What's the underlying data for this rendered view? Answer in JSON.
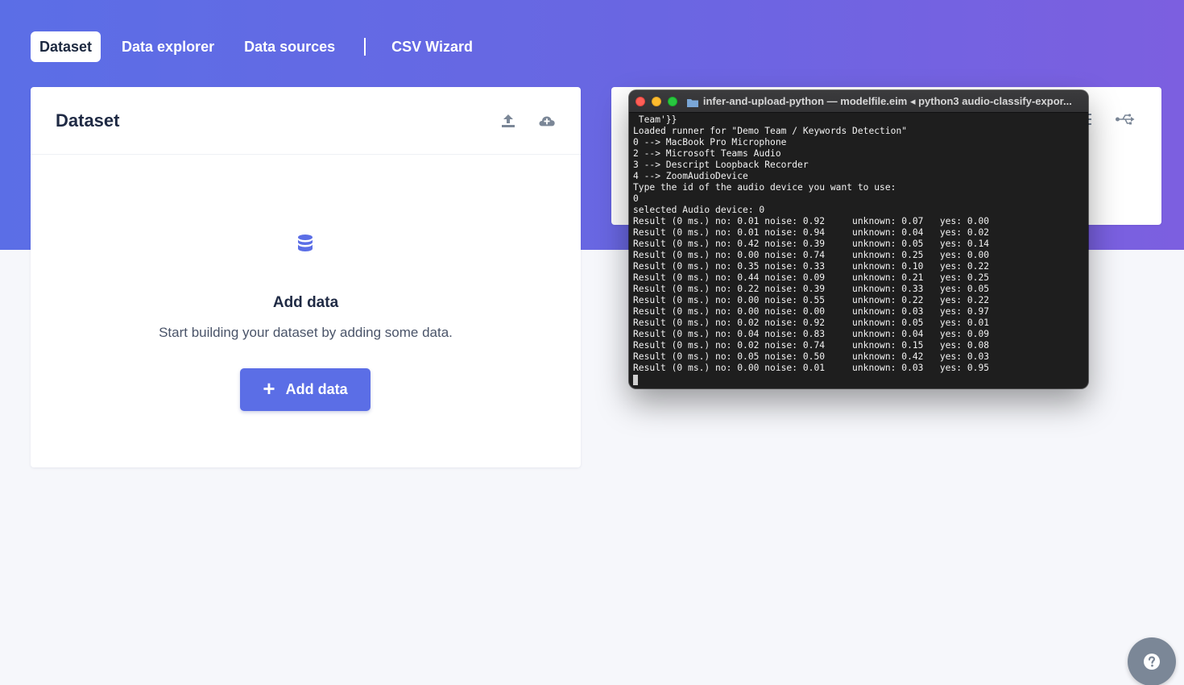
{
  "nav": {
    "tabs": [
      {
        "label": "Dataset",
        "active": true
      },
      {
        "label": "Data explorer",
        "active": false
      },
      {
        "label": "Data sources",
        "active": false
      },
      {
        "label": "CSV Wizard",
        "active": false
      }
    ]
  },
  "dataset_card": {
    "title": "Dataset",
    "header_icons": [
      "upload-icon",
      "cloud-upload-icon"
    ],
    "empty_state": {
      "icon": "database-icon",
      "title": "Add data",
      "description": "Start building your dataset by adding some data.",
      "button_label": "Add data",
      "button_icon": "plus-icon"
    }
  },
  "right_card": {
    "header_icons": [
      "list-icon",
      "usb-icon"
    ]
  },
  "terminal": {
    "title": "infer-and-upload-python — modelfile.eim ◂ python3 audio-classify-expor...",
    "lines": [
      " Team'}}",
      "Loaded runner for \"Demo Team / Keywords Detection\"",
      "0 --> MacBook Pro Microphone",
      "2 --> Microsoft Teams Audio",
      "3 --> Descript Loopback Recorder",
      "4 --> ZoomAudioDevice",
      "Type the id of the audio device you want to use:",
      "0",
      "selected Audio device: 0",
      "Result (0 ms.) no: 0.01 noise: 0.92     unknown: 0.07   yes: 0.00",
      "Result (0 ms.) no: 0.01 noise: 0.94     unknown: 0.04   yes: 0.02",
      "Result (0 ms.) no: 0.42 noise: 0.39     unknown: 0.05   yes: 0.14",
      "Result (0 ms.) no: 0.00 noise: 0.74     unknown: 0.25   yes: 0.00",
      "Result (0 ms.) no: 0.35 noise: 0.33     unknown: 0.10   yes: 0.22",
      "Result (0 ms.) no: 0.44 noise: 0.09     unknown: 0.21   yes: 0.25",
      "Result (0 ms.) no: 0.22 noise: 0.39     unknown: 0.33   yes: 0.05",
      "Result (0 ms.) no: 0.00 noise: 0.55     unknown: 0.22   yes: 0.22",
      "Result (0 ms.) no: 0.00 noise: 0.00     unknown: 0.03   yes: 0.97",
      "Result (0 ms.) no: 0.02 noise: 0.92     unknown: 0.05   yes: 0.01",
      "Result (0 ms.) no: 0.04 noise: 0.83     unknown: 0.04   yes: 0.09",
      "Result (0 ms.) no: 0.02 noise: 0.74     unknown: 0.15   yes: 0.08",
      "Result (0 ms.) no: 0.05 noise: 0.50     unknown: 0.42   yes: 0.03",
      "Result (0 ms.) no: 0.00 noise: 0.01     unknown: 0.03   yes: 0.95"
    ]
  },
  "help": {
    "icon": "help-icon"
  },
  "colors": {
    "accent": "#5b6ee6",
    "hero_gradient_start": "#5b6ee6",
    "hero_gradient_end": "#7c5fe0",
    "terminal_bg": "#1e1e1e"
  }
}
